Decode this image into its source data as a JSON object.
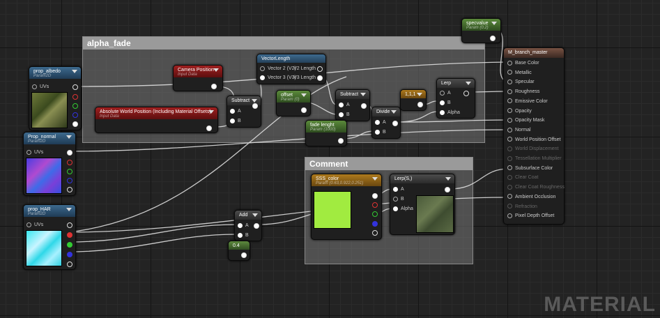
{
  "comments": {
    "alpha_fade": "alpha_fade",
    "comment": "Comment"
  },
  "nodes": {
    "prop_albedo": {
      "title": "prop_albedo",
      "sub": "Param2D",
      "uv": "UVs"
    },
    "prop_normal": {
      "title": "Prop_normal",
      "sub": "Param2D",
      "uv": "UVs"
    },
    "prop_har": {
      "title": "prop_HAR",
      "sub": "Param2D",
      "uv": "UVs"
    },
    "camera_position": {
      "title": "Camera Position",
      "sub": "Input Data"
    },
    "absolute_world_position": {
      "title": "Absolute World Position (Including Material Offsets)",
      "sub": "Input Data"
    },
    "vector_length": {
      "title": "VectorLength",
      "in1": "Vector 2 (V2)",
      "in2": "Vector 3 (V3)",
      "out1": "V2 Length",
      "out2": "V3 Length"
    },
    "subtract1": {
      "title": "Subtract",
      "a": "A",
      "b": "B"
    },
    "offset": {
      "title": "offset",
      "sub": "Param (0)"
    },
    "subtract2": {
      "title": "Subtract",
      "a": "A",
      "b": "B"
    },
    "fade_lenght": {
      "title": "fade lenght",
      "sub": "Param (1000)"
    },
    "divide": {
      "title": "Divide",
      "a": "A",
      "b": "B"
    },
    "const3": {
      "title": "1,1,1"
    },
    "lerp": {
      "title": "Lerp",
      "a": "A",
      "b": "B",
      "alpha": "Alpha"
    },
    "specvalue": {
      "title": "specvalue",
      "sub": "Param (0.2)"
    },
    "add": {
      "title": "Add",
      "a": "A",
      "b": "B"
    },
    "const04": {
      "title": "0.4"
    },
    "sss_color": {
      "title": "SSS_color",
      "sub": "Param (0.63,0.922,0.251)"
    },
    "lerp_s": {
      "title": "Lerp(S,)",
      "a": "A",
      "b": "B",
      "alpha": "Alpha"
    }
  },
  "master": {
    "title": "M_branch_master",
    "pins": [
      {
        "label": "Base Color",
        "enabled": true
      },
      {
        "label": "Metallic",
        "enabled": true
      },
      {
        "label": "Specular",
        "enabled": true
      },
      {
        "label": "Roughness",
        "enabled": true
      },
      {
        "label": "Emissive Color",
        "enabled": true
      },
      {
        "label": "Opacity",
        "enabled": true
      },
      {
        "label": "Opacity Mask",
        "enabled": true
      },
      {
        "label": "Normal",
        "enabled": true
      },
      {
        "label": "World Position Offset",
        "enabled": true
      },
      {
        "label": "World Displacement",
        "enabled": false
      },
      {
        "label": "Tessellation Multiplier",
        "enabled": false
      },
      {
        "label": "Subsurface Color",
        "enabled": true
      },
      {
        "label": "Clear Coat",
        "enabled": false
      },
      {
        "label": "Clear Coat Roughness",
        "enabled": false
      },
      {
        "label": "Ambient Occlusion",
        "enabled": true
      },
      {
        "label": "Refraction",
        "enabled": false
      },
      {
        "label": "Pixel Depth Offset",
        "enabled": true
      }
    ]
  },
  "watermark": "MATERIAL",
  "colors": {
    "texture_header": "#3d6a8e",
    "input_header": "#a02020",
    "param_header": "#5b8a3b",
    "math_header": "#4c4c4c",
    "const_header": "#ae7a1d",
    "master_header": "#785243",
    "sss_swatch": "#a1eb40"
  }
}
